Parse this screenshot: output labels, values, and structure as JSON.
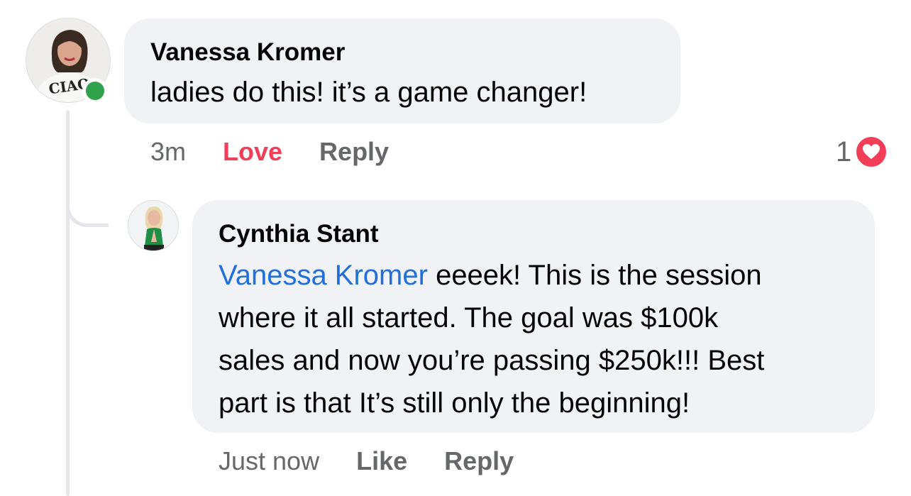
{
  "comments": [
    {
      "author": "Vanessa Kromer",
      "text": "ladies do this! it’s a game changer!",
      "time": "3m",
      "actions": [
        "Love",
        "Reply"
      ],
      "reaction_count": "1",
      "reaction_icon": "heart-icon",
      "online": true,
      "avatar_shirt_text": "CIAO"
    },
    {
      "author": "Cynthia Stant",
      "mention": "Vanessa Kromer",
      "text_lines": [
        " eeeek! This is the session",
        "where it all started. The goal was $100k",
        "sales and now you’re passing $250k!!! Best",
        "part is that It’s still only the beginning!"
      ],
      "time": "Just now",
      "actions": [
        "Like",
        "Reply"
      ]
    }
  ],
  "colors": {
    "bubble": "#f0f2f5",
    "mention": "#216fdb",
    "love": "#f33e58",
    "online": "#31a24c",
    "meta": "#65676b"
  }
}
